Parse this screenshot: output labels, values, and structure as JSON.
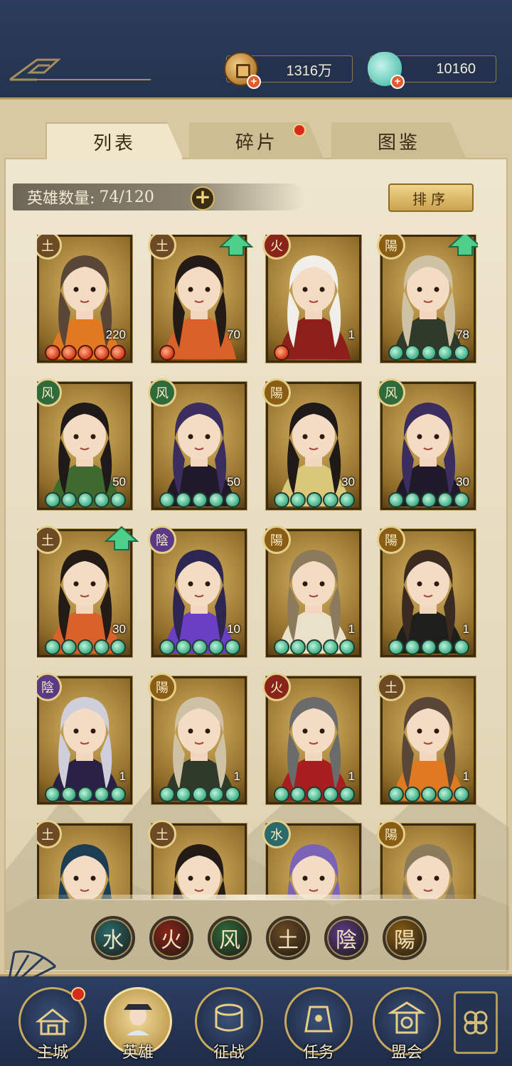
{
  "currency": {
    "coins": "1316万",
    "jade": "10160",
    "coin_icon": "coin-icon",
    "jade_icon": "jade-pouch-icon"
  },
  "tabs": [
    {
      "label": "列表",
      "active": true
    },
    {
      "label": "碎片",
      "active": false,
      "badge": true
    },
    {
      "label": "图鉴",
      "active": false
    }
  ],
  "hero_count": {
    "label": "英雄数量:",
    "value": "74/120"
  },
  "sort_label": "排序",
  "elements": {
    "earth": {
      "glyph": "土",
      "color": "#6b4a24"
    },
    "fire": {
      "glyph": "火",
      "color": "#8a2418"
    },
    "wind": {
      "glyph": "风",
      "color": "#2f6a3a"
    },
    "yin": {
      "glyph": "陰",
      "color": "#5a3a84"
    },
    "yang": {
      "glyph": "陽",
      "color": "#8a5d15"
    },
    "water": {
      "glyph": "水",
      "color": "#2a6a6a"
    }
  },
  "heroes": [
    {
      "element": "earth",
      "level": "220",
      "stars": 5,
      "star_color": "red",
      "upgrade": false,
      "hair": "#5a4636",
      "outfit": "#e07a22"
    },
    {
      "element": "earth",
      "level": "70",
      "stars": 1,
      "star_color": "red",
      "upgrade": true,
      "hair": "#241a16",
      "outfit": "#d8622a"
    },
    {
      "element": "fire",
      "level": "1",
      "stars": 1,
      "star_color": "red",
      "upgrade": false,
      "hair": "#f1efe9",
      "outfit": "#8d1f1a"
    },
    {
      "element": "yang",
      "level": "78",
      "stars": 5,
      "star_color": "green",
      "upgrade": true,
      "hair": "#cfc2a4",
      "outfit": "#2f3a2a"
    },
    {
      "element": "wind",
      "level": "50",
      "stars": 5,
      "star_color": "green",
      "upgrade": false,
      "hair": "#1f1a17",
      "outfit": "#3f6a2e"
    },
    {
      "element": "wind",
      "level": "50",
      "stars": 5,
      "star_color": "green",
      "upgrade": false,
      "hair": "#3b2e5e",
      "outfit": "#1f1a2a"
    },
    {
      "element": "yang",
      "level": "30",
      "stars": 5,
      "star_color": "green",
      "upgrade": false,
      "hair": "#1f1a17",
      "outfit": "#d9c77a"
    },
    {
      "element": "wind",
      "level": "30",
      "stars": 5,
      "star_color": "green",
      "upgrade": false,
      "hair": "#3b2e5e",
      "outfit": "#1f1a2a"
    },
    {
      "element": "earth",
      "level": "30",
      "stars": 5,
      "star_color": "green",
      "upgrade": true,
      "hair": "#241a16",
      "outfit": "#d8622a"
    },
    {
      "element": "yin",
      "level": "10",
      "stars": 5,
      "star_color": "green",
      "upgrade": false,
      "hair": "#2d2552",
      "outfit": "#6a3fc4"
    },
    {
      "element": "yang",
      "level": "1",
      "stars": 5,
      "star_color": "green",
      "upgrade": false,
      "hair": "#8c7a5c",
      "outfit": "#e9e1c8"
    },
    {
      "element": "yang",
      "level": "1",
      "stars": 5,
      "star_color": "green",
      "upgrade": false,
      "hair": "#3a2a1f",
      "outfit": "#1e1e1a"
    },
    {
      "element": "yin",
      "level": "1",
      "stars": 5,
      "star_color": "green",
      "upgrade": false,
      "hair": "#cfcfdc",
      "outfit": "#2a1f44"
    },
    {
      "element": "yang",
      "level": "1",
      "stars": 5,
      "star_color": "green",
      "upgrade": false,
      "hair": "#cfc2a4",
      "outfit": "#2f3a2a"
    },
    {
      "element": "fire",
      "level": "1",
      "stars": 5,
      "star_color": "green",
      "upgrade": false,
      "hair": "#6b6b6b",
      "outfit": "#a81e1e"
    },
    {
      "element": "earth",
      "level": "1",
      "stars": 5,
      "star_color": "green",
      "upgrade": false,
      "hair": "#5a4636",
      "outfit": "#e07a22"
    },
    {
      "element": "earth",
      "level": "",
      "stars": 0,
      "star_color": "green",
      "upgrade": false,
      "hair": "#1d3e52",
      "outfit": "#2f4a5a"
    },
    {
      "element": "earth",
      "level": "",
      "stars": 0,
      "star_color": "green",
      "upgrade": false,
      "hair": "#241a16",
      "outfit": "#d8622a"
    },
    {
      "element": "water",
      "level": "",
      "stars": 0,
      "star_color": "green",
      "upgrade": false,
      "hair": "#7b63b8",
      "outfit": "#3a2a5a"
    },
    {
      "element": "yang",
      "level": "",
      "stars": 0,
      "star_color": "green",
      "upgrade": false,
      "hair": "#8c7a5c",
      "outfit": "#e9e1c8"
    }
  ],
  "filters": [
    "water",
    "fire",
    "wind",
    "earth",
    "yin",
    "yang"
  ],
  "nav": [
    {
      "label": "主城",
      "icon": "palace-icon",
      "badge": true,
      "active": false
    },
    {
      "label": "英雄",
      "icon": "hero-portrait-icon",
      "badge": false,
      "active": true
    },
    {
      "label": "征战",
      "icon": "war-drum-icon",
      "badge": false,
      "active": false
    },
    {
      "label": "任务",
      "icon": "quest-bell-icon",
      "badge": false,
      "active": false
    },
    {
      "label": "盟会",
      "icon": "pavilion-icon",
      "badge": false,
      "active": false
    }
  ],
  "menu_icon": "flower-menu-icon"
}
